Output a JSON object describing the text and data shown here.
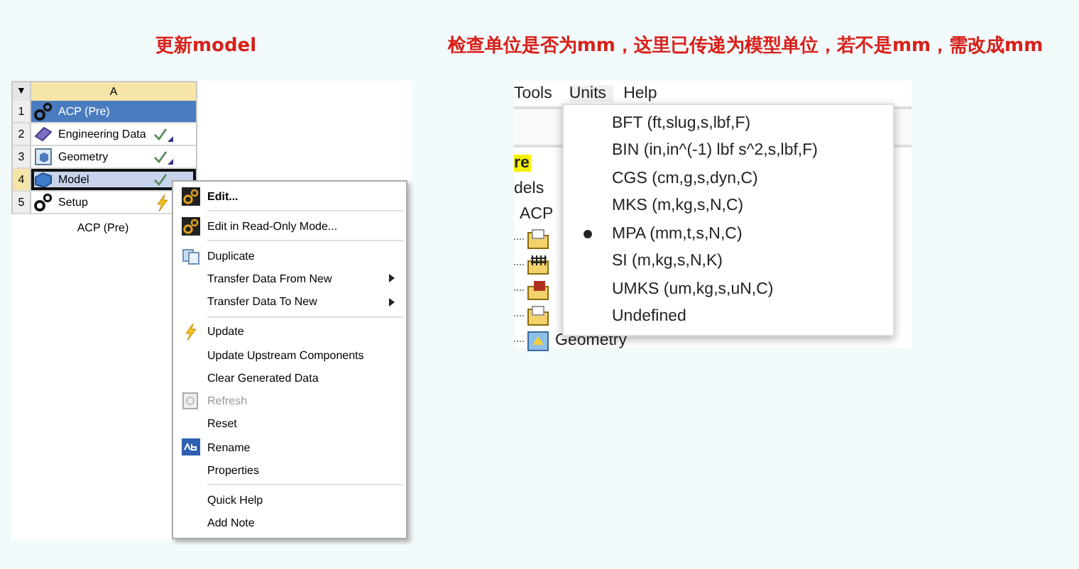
{
  "left_title": "更新model",
  "right_title": "检查单位是否为mm，这里已传递为模型单位，若不是mm，需改成mm",
  "system": {
    "header_arrow": "▼",
    "column": "A",
    "caption": "ACP (Pre)",
    "rows": [
      {
        "number": "1",
        "label": "ACP (Pre)",
        "kind": "gears",
        "up_to_date": false,
        "needs_update": false,
        "corner_mark": false,
        "selected": true,
        "focused": false
      },
      {
        "number": "2",
        "label": "Engineering Data",
        "kind": "book",
        "up_to_date": true,
        "needs_update": false,
        "corner_mark": true,
        "selected": false,
        "focused": false
      },
      {
        "number": "3",
        "label": "Geometry",
        "kind": "cube",
        "up_to_date": true,
        "needs_update": false,
        "corner_mark": true,
        "selected": false,
        "focused": false
      },
      {
        "number": "4",
        "label": "Model",
        "kind": "solid",
        "up_to_date": true,
        "needs_update": false,
        "corner_mark": false,
        "selected": false,
        "focused": true
      },
      {
        "number": "5",
        "label": "Setup",
        "kind": "gears",
        "up_to_date": false,
        "needs_update": true,
        "corner_mark": false,
        "selected": false,
        "focused": false
      }
    ]
  },
  "context_menu": {
    "items": [
      {
        "label": "Edit...",
        "kind": "gears",
        "bold": true,
        "disabled": false,
        "submenu": false,
        "separator_after": true
      },
      {
        "label": "Edit in Read-Only Mode...",
        "kind": "gears",
        "bold": false,
        "disabled": false,
        "submenu": false,
        "separator_after": true
      },
      {
        "label": "Duplicate",
        "kind": "copy",
        "bold": false,
        "disabled": false,
        "submenu": false,
        "separator_after": false
      },
      {
        "label": "Transfer Data From New",
        "kind": "plain",
        "bold": false,
        "disabled": false,
        "submenu": true,
        "separator_after": false
      },
      {
        "label": "Transfer Data To New",
        "kind": "plain",
        "bold": false,
        "disabled": false,
        "submenu": true,
        "separator_after": true
      },
      {
        "label": "Update",
        "kind": "lightning",
        "bold": false,
        "disabled": false,
        "submenu": false,
        "separator_after": false
      },
      {
        "label": "Update Upstream Components",
        "kind": "plain",
        "bold": false,
        "disabled": false,
        "submenu": false,
        "separator_after": false
      },
      {
        "label": "Clear Generated Data",
        "kind": "plain",
        "bold": false,
        "disabled": false,
        "submenu": false,
        "separator_after": false
      },
      {
        "label": "Refresh",
        "kind": "page",
        "bold": false,
        "disabled": true,
        "submenu": false,
        "separator_after": false
      },
      {
        "label": "Reset",
        "kind": "plain",
        "bold": false,
        "disabled": false,
        "submenu": false,
        "separator_after": false
      },
      {
        "label": "Rename",
        "kind": "rename",
        "bold": false,
        "disabled": false,
        "submenu": false,
        "separator_after": false
      },
      {
        "label": "Properties",
        "kind": "plain",
        "bold": false,
        "disabled": false,
        "submenu": false,
        "separator_after": true
      },
      {
        "label": "Quick Help",
        "kind": "plain",
        "bold": false,
        "disabled": false,
        "submenu": false,
        "separator_after": false
      },
      {
        "label": "Add Note",
        "kind": "plain",
        "bold": false,
        "disabled": false,
        "submenu": false,
        "separator_after": false
      }
    ]
  },
  "units_window": {
    "menu_bar": [
      {
        "label": "Tools",
        "open": false
      },
      {
        "label": "Units",
        "open": true
      },
      {
        "label": "Help",
        "open": false
      }
    ],
    "tree": [
      {
        "kind": "text",
        "text": "re",
        "selected": true
      },
      {
        "kind": "text",
        "text": "dels",
        "selected": false
      },
      {
        "kind": "text",
        "text": "ACP",
        "selected": false
      },
      {
        "kind": "folder",
        "selected": false
      },
      {
        "kind": "mesh",
        "selected": false
      },
      {
        "kind": "red-folder",
        "selected": false
      },
      {
        "kind": "folder",
        "selected": false
      },
      {
        "kind": "geometry",
        "text": "Geometry",
        "selected": false
      }
    ],
    "units_menu": [
      {
        "label": "BFT (ft,slug,s,lbf,F)",
        "selected": false
      },
      {
        "label": "BIN (in,in^(-1) lbf s^2,s,lbf,F)",
        "selected": false
      },
      {
        "label": "CGS (cm,g,s,dyn,C)",
        "selected": false
      },
      {
        "label": "MKS (m,kg,s,N,C)",
        "selected": false
      },
      {
        "label": "MPA (mm,t,s,N,C)",
        "selected": true
      },
      {
        "label": "SI (m,kg,s,N,K)",
        "selected": false
      },
      {
        "label": "UMKS (um,kg,s,uN,C)",
        "selected": false
      },
      {
        "label": "Undefined",
        "selected": false
      }
    ]
  }
}
